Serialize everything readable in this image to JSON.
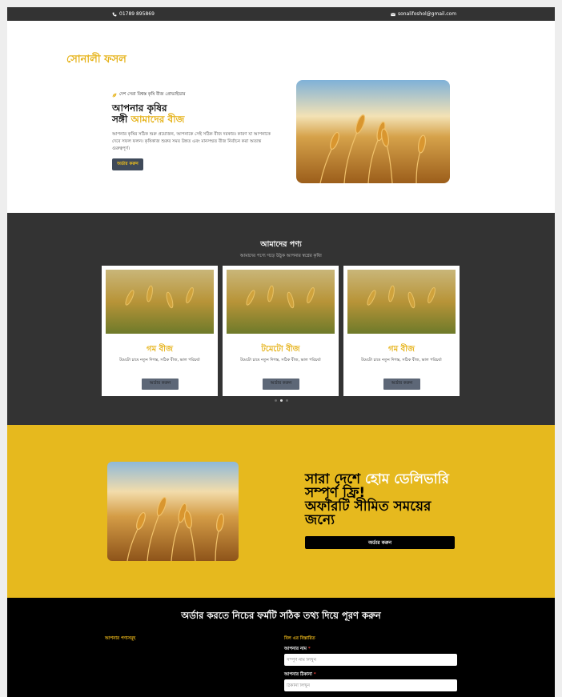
{
  "topbar": {
    "phone": "01789 895869",
    "email": "sonalifoshol@gmail.com"
  },
  "brand": "সোনালী ফসল",
  "hero": {
    "tag": "দেশ সেরা বিশ্বস্ত কৃষি বীজ প্রোভাইডার",
    "title_line1": "আপনার কৃষির",
    "title_line2_plain": "সঙ্গী ",
    "title_line2_accent": "আমাদের বীজ",
    "description": "আপনার কৃষির সঠিক শুরু প্রয়োজন, আপনাকে সেই সঠিক বীজ দরকার। কারণ যা আপনাকে দেবে সফল ফলন। কৃষিকাজ শুরুর সময় উন্নত এবং মানসম্মত বীজ নির্বাচন করা অত্যন্ত গুরুত্বপূর্ণ।",
    "button": "অর্ডার করুন"
  },
  "products": {
    "title": "আমাদের পণ্য",
    "subtitle": "আমাদের পণ্যে গড়ে উঠুক আপনার স্বপ্নের কৃষি!",
    "cards": [
      {
        "name": "গম বীজ",
        "desc": "টমেটো চাষে নতুন দিগন্ত, সঠিক বীজ, ভাল পরিচর্যা",
        "button": "অর্ডার করুন"
      },
      {
        "name": "টমেটো বীজ",
        "desc": "টমেটো চাষে নতুন দিগন্ত, সঠিক বীজ, ভাল পরিচর্যা",
        "button": "অর্ডার করুন"
      },
      {
        "name": "গম বীজ",
        "desc": "টমেটো চাষে নতুন দিগন্ত, সঠিক বীজ, ভাল পরিচর্যা",
        "button": "অর্ডার করুন"
      }
    ]
  },
  "offer": {
    "title_plain1": "সারা দেশে ",
    "title_accent": "হোম ডেলিভারি",
    "title_plain2": "সম্পূর্ণ ফ্রি!",
    "title_line3": "অফারটি সীমিত সময়ের জন্যে",
    "button": "অর্ডার করুন"
  },
  "order": {
    "title": "অর্ডার করতে নিচের ফর্মটি সঠিক তথ্য দিয়ে পূরণ করুন",
    "products_heading": "আপনার পণ্যসমূহ",
    "billing_heading": "বিল এর বিস্তারিত",
    "name_label": "আপনার নাম",
    "name_placeholder": "সম্পূর্ণ নাম লিখুন",
    "address_label": "আপনার ঠিকানা",
    "address_placeholder": "ঠিকানা লিখুন",
    "required_mark": "*"
  },
  "colors": {
    "accent": "#e6b31a",
    "dark": "#333333",
    "offer_bg": "#e6b91e",
    "button_dark": "#3f4a5a"
  },
  "icons": {
    "phone": "phone-icon",
    "email": "mail-icon",
    "tag": "leaf-icon"
  }
}
